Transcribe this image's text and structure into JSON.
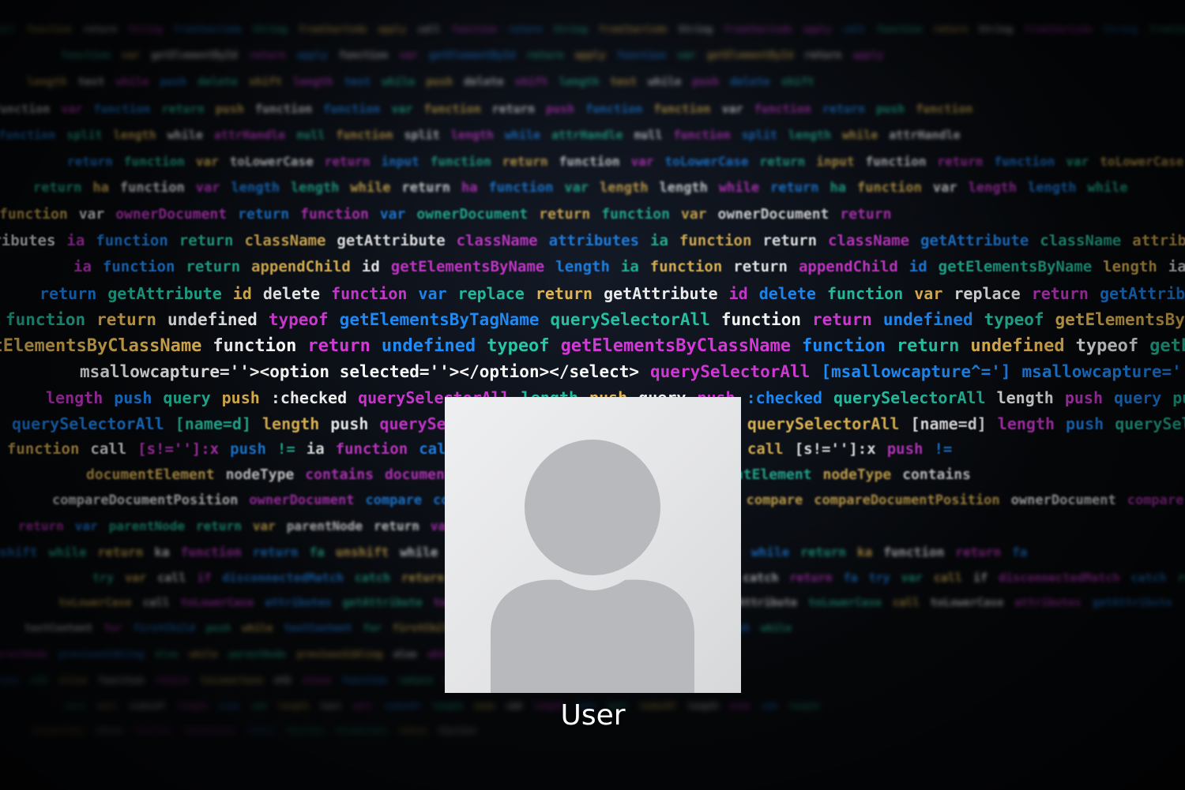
{
  "lock_screen": {
    "user": {
      "display_name": "User",
      "avatar_icon": "default-user-avatar-icon"
    },
    "background": {
      "description_icon": "code-wallpaper",
      "palette": [
        "#1f8fff",
        "#27c9a8",
        "#f2c45a",
        "#ffffff",
        "#d63ad9"
      ],
      "lines": [
        [
          "apply",
          "call",
          "function",
          "return",
          "String",
          "fromCharCode",
          "String",
          "fromCharCode"
        ],
        [
          "function",
          "var",
          "getElementById",
          "return",
          "apply"
        ],
        [
          "length",
          "test",
          "while",
          "push",
          "delete",
          "shift"
        ],
        [
          "function",
          "var",
          "function",
          "return",
          "push",
          "function"
        ],
        [
          "null",
          "function",
          "split",
          "length",
          "while",
          "attrHandle"
        ],
        [
          "return",
          "function",
          "var",
          "toLowerCase",
          "return",
          "input",
          "function"
        ],
        [
          "return",
          "ha",
          "function",
          "var",
          "length",
          "length",
          "while"
        ],
        [
          "function",
          "var",
          "ownerDocument",
          "return"
        ],
        [
          "attributes",
          "ia",
          "function",
          "return",
          "className",
          "getAttribute",
          "className"
        ],
        [
          "ia",
          "function",
          "return",
          "appendChild",
          "id",
          "getElementsByName",
          "length"
        ],
        [
          "return",
          "getAttribute",
          "id",
          "delete",
          "function",
          "var",
          "replace"
        ],
        [
          "function",
          "return",
          "undefined",
          "typeof",
          "getElementsByTagName",
          "querySelectorAll"
        ],
        [
          "getElementsByClassName",
          "function",
          "return",
          "undefined",
          "typeof"
        ],
        [
          "msallowcapture=''><option selected=''></option></select>",
          "querySelectorAll",
          "[msallowcapture^=']"
        ],
        [
          "length",
          "push",
          "query",
          "push",
          ":checked",
          "querySelectorAll"
        ],
        [
          "querySelectorAll",
          "[name=d]",
          "length",
          "push",
          "querySelectorAll",
          ":enabled",
          "length",
          "push"
        ],
        [
          "ia",
          "function",
          "call",
          "[s!='']:x",
          "push",
          "!="
        ],
        [
          "documentElement",
          "nodeType",
          "contains"
        ],
        [
          "compareDocumentPosition",
          "ownerDocument",
          "compare"
        ],
        [
          "return",
          "var",
          "parentNode"
        ],
        [
          "unshift",
          "while",
          "return",
          "ka",
          "function",
          "return",
          "fa"
        ],
        [
          "try",
          "var",
          "call",
          "if",
          "disconnectedMatch",
          "catch",
          "return",
          "fa"
        ],
        [
          "toLowerCase",
          "call",
          "toLowerCase",
          "attributes",
          "getAttribute"
        ],
        [
          "textContent",
          "for",
          "firstChild",
          "push",
          "while"
        ],
        [
          "parentNode",
          "previousSibling",
          "else",
          "while"
        ],
        [
          "toLowerCase",
          "nth",
          "slice",
          "function",
          "return"
        ],
        [
          "test",
          "null",
          "indexOf",
          "length",
          "even",
          "odd",
          "length"
        ],
        [
          "toLowerCase",
          "return",
          "function"
        ]
      ]
    }
  }
}
